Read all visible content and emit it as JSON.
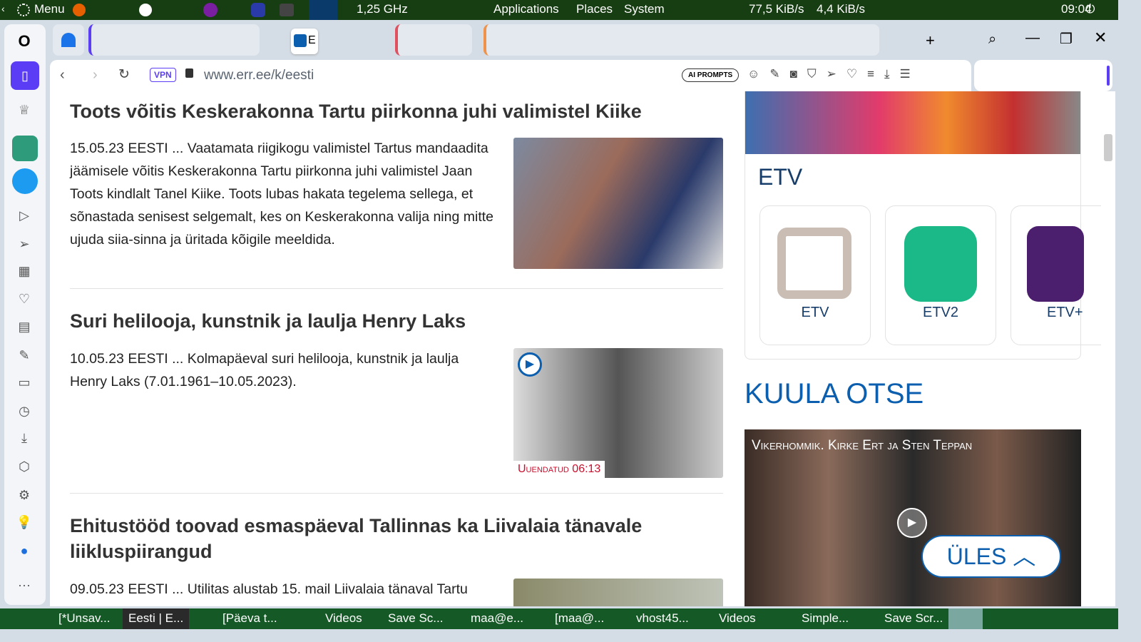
{
  "topbar": {
    "menu": "Menu",
    "cpu": "1,25 GHz",
    "applications": "Applications",
    "places": "Places",
    "system": "System",
    "net_down": "77,5 KiB/s",
    "net_up": "4,4 KiB/s",
    "clock": "09:04"
  },
  "browser": {
    "url": "www.err.ee/k/eesti",
    "vpn": "VPN",
    "ai_prompts": "AI PROMPTS",
    "active_tab": "E"
  },
  "articles": [
    {
      "title": "Toots võitis Keskerakonna Tartu piirkonna juhi valimistel Kiike",
      "text": "15.05.23 EESTI ... Vaatamata riigikogu valimistel Tartus mandaadita jäämisele võitis Keskerakonna Tartu piirkonna juhi valimistel Jaan Toots kindlalt Tanel Kiike. Toots lubas hakata tegelema sellega, et sõnastada senisest selgemalt, kes on Keskerakonna valija ning mitte ujuda siia-sinna ja üritada kõigile meeldida."
    },
    {
      "title": "Suri helilooja, kunstnik ja laulja Henry Laks",
      "text": "10.05.23 EESTI ... Kolmapäeval suri helilooja, kunstnik ja laulja Henry Laks (7.01.1961–10.05.2023).",
      "badge": "Uuendatud 06:13"
    },
    {
      "title": "Ehitustööd toovad esmaspäeval Tallinnas ka Liivalaia tänavale liikluspiirangud",
      "text": "09.05.23 EESTI ... Utilitas alustab 15. mail Liivalaia tänaval Tartu"
    }
  ],
  "etv": {
    "heading": "ETV",
    "channels": [
      "ETV",
      "ETV2",
      "ETV+"
    ]
  },
  "kuula": {
    "heading": "KUULA OTSE",
    "show": "Vikerhommik. Kirke Ert ja Sten Teppan",
    "up": "ÜLES"
  },
  "taskbar": [
    "[*Unsav...",
    "Eesti | E...",
    "[Päeva t...",
    "Videos",
    "Save Sc...",
    "maa@e...",
    "[maa@...",
    "vhost45...",
    "Videos",
    "Simple...",
    "Save Scr..."
  ],
  "colors": {
    "accent": "#5b3df5",
    "err_blue": "#0b5fae",
    "topbar": "#173d12",
    "taskbar": "#155a26",
    "badge": "#c8102e"
  }
}
